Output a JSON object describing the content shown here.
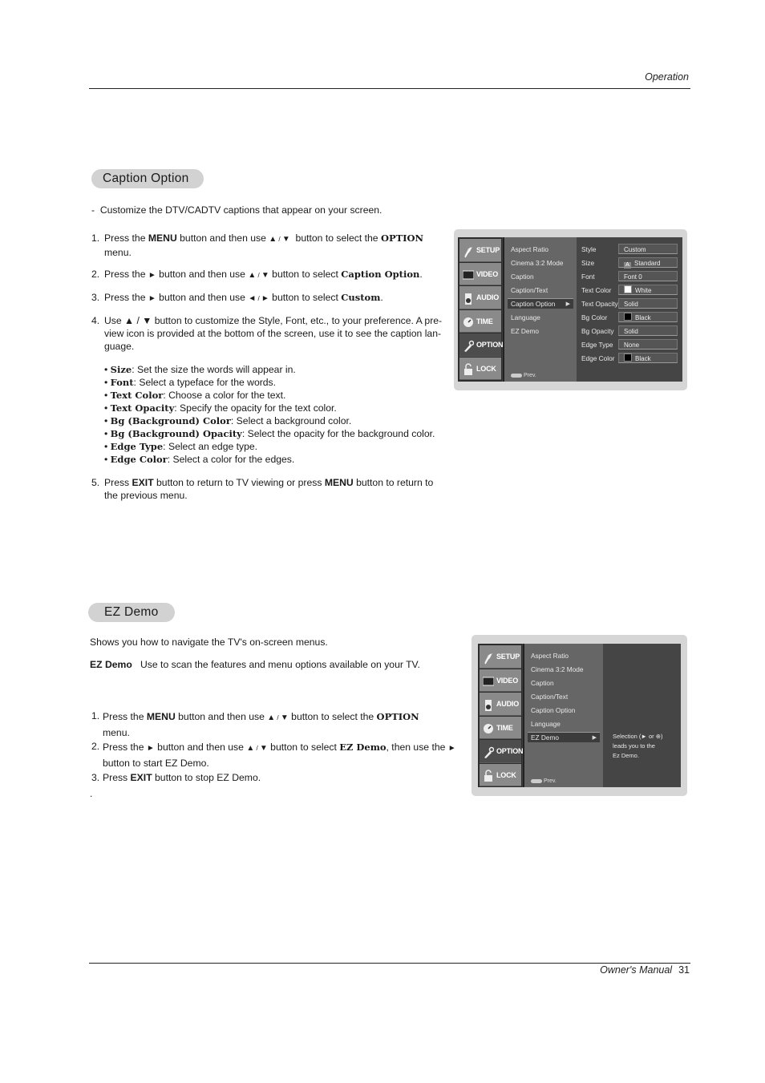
{
  "header": {
    "section": "Operation"
  },
  "footer": {
    "label": "Owner's Manual",
    "page": "31"
  },
  "caption_option": {
    "title": "Caption Option",
    "intro": "Customize the DTV/CADTV captions that appear on your screen.",
    "steps": [
      {
        "num": "1.",
        "parts": [
          "Press the ",
          "MENU",
          " button and then use ",
          "▲",
          " / ",
          "▼",
          " button to select the ",
          "OPTION",
          " menu."
        ]
      },
      {
        "num": "2.",
        "parts": [
          "Press the ",
          "►",
          " button and then use ",
          "▲",
          " / ",
          "▼",
          " button to select ",
          "Caption Option",
          "."
        ]
      },
      {
        "num": "3.",
        "parts": [
          "Press the ",
          "►",
          " button and then use ",
          "◄",
          " / ",
          "►",
          " button to select ",
          "Custom",
          "."
        ]
      },
      {
        "num": "4.",
        "text": "Use ▲ / ▼ button to customize the Style, Font, etc., to your preference. A pre-view icon is provided at the bottom of the screen, use it to see the caption lan-guage."
      },
      {
        "num": "5.",
        "parts": [
          "Press ",
          "EXIT",
          " button to return to TV viewing or press ",
          "MENU",
          " button to return to the previous menu."
        ]
      }
    ],
    "step4_line1": "Use ▲ / ▼ button to customize the Style, Font, etc., to your preference. A pre-",
    "step4_line2": "view icon is provided at the bottom of the screen, use it to see the caption lan-",
    "step4_line3": "guage.",
    "bullets": [
      {
        "term": "Size",
        "desc": ": Set the size the words will appear in."
      },
      {
        "term": "Font",
        "desc": ": Select a typeface for the words."
      },
      {
        "term": "Text Color",
        "desc": ": Choose a color for the text."
      },
      {
        "term": "Text Opacity",
        "desc": ": Specify the opacity for the text color."
      },
      {
        "term": "Bg (Background) Color",
        "desc": ": Select a background color."
      },
      {
        "term": "Bg (Background) Opacity",
        "desc": ": Select the opacity for the background color."
      },
      {
        "term": "Edge Type",
        "desc": ": Select an edge type."
      },
      {
        "term": "Edge Color",
        "desc": ": Select a color for the edges."
      }
    ]
  },
  "ez_demo": {
    "title": "EZ Demo",
    "intro": "Shows you how to navigate the TV's on-screen menus.",
    "def_term": "EZ Demo",
    "def_text": "Use to scan the features and menu options available on your TV.",
    "step1": [
      "Press the ",
      "MENU",
      " button and then use ",
      "▲",
      " / ",
      "▼",
      "  button to select the ",
      "OPTION",
      "menu."
    ],
    "step2": [
      "Press the ",
      "►",
      " button and then use ",
      "▲",
      " / ",
      "▼",
      " button to select ",
      "EZ Demo",
      ", then use the ",
      "►",
      "button to start EZ Demo."
    ],
    "step3": [
      "Press ",
      "EXIT",
      " button to stop EZ Demo."
    ],
    "trailing": "."
  },
  "tv_menu": {
    "tabs": [
      {
        "label": "SETUP",
        "icon": "satellite-dish-icon"
      },
      {
        "label": "VIDEO",
        "icon": "monitor-icon"
      },
      {
        "label": "AUDIO",
        "icon": "speaker-icon"
      },
      {
        "label": "TIME",
        "icon": "clock-icon"
      },
      {
        "label": "OPTION",
        "icon": "wrench-icon",
        "selected": true
      },
      {
        "label": "LOCK",
        "icon": "padlock-icon"
      }
    ],
    "option_items": [
      "Aspect Ratio",
      "Cinema 3:2 Mode",
      "Caption",
      "Caption/Text",
      "Caption Option",
      "Language",
      "EZ Demo"
    ],
    "prev_label": "Prev.",
    "caption_settings": [
      {
        "label": "Style",
        "value": "Custom"
      },
      {
        "label": "Size",
        "value": "Standard",
        "icon": "A"
      },
      {
        "label": "Font",
        "value": "Font 0"
      },
      {
        "label": "Text Color",
        "value": "White",
        "swatch": "#ffffff"
      },
      {
        "label": "Text Opacity",
        "value": "Solid"
      },
      {
        "label": "Bg Color",
        "value": "Black",
        "swatch": "#000000"
      },
      {
        "label": "Bg Opacity",
        "value": "Solid"
      },
      {
        "label": "Edge Type",
        "value": "None"
      },
      {
        "label": "Edge Color",
        "value": "Black",
        "swatch": "#000000"
      }
    ],
    "screen1_selected": "Caption Option",
    "screen2_selected": "EZ Demo",
    "ez_help": [
      "Selection (► or ⊕)",
      "leads you to the",
      "Ez Demo."
    ]
  }
}
